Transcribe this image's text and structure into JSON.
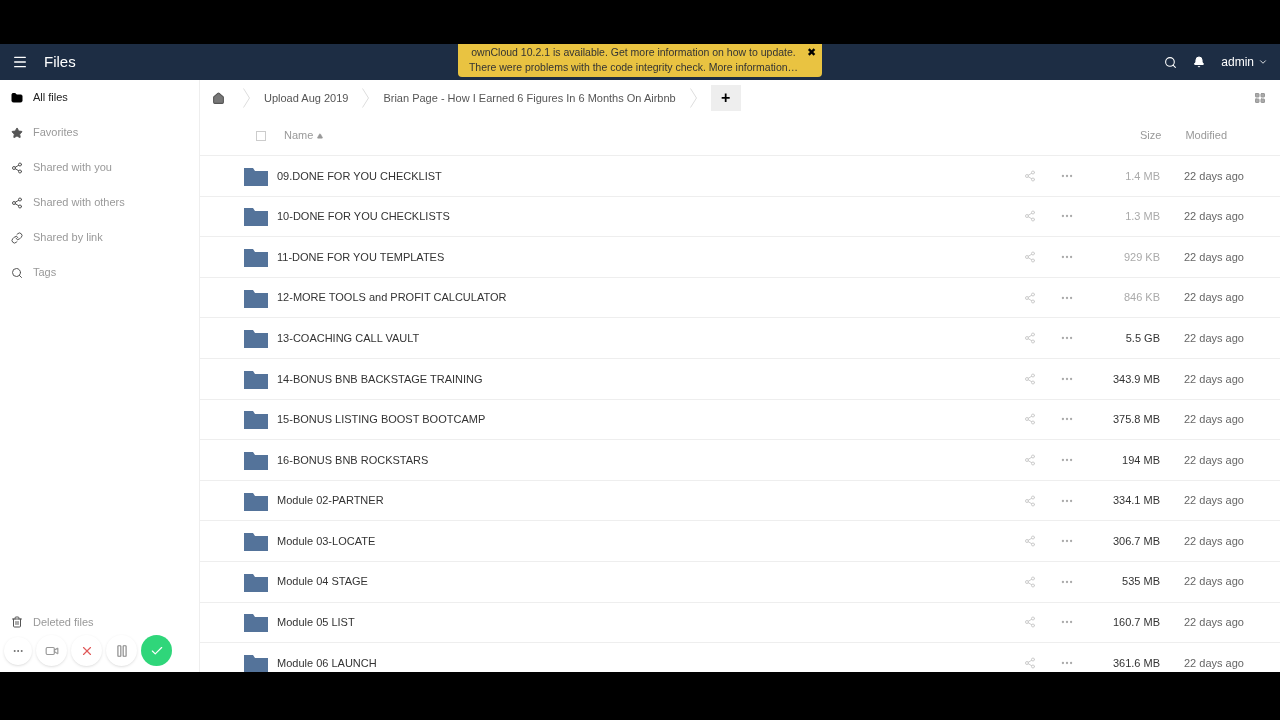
{
  "header": {
    "title": "Files",
    "user": "admin"
  },
  "notice": {
    "lines": [
      "ownCloud 10.2.1 is available. Get more information on how to update.",
      "There were problems with the code integrity check. More information…"
    ],
    "close": "✖"
  },
  "sidebar": {
    "items": [
      {
        "label": "All files",
        "selected": true
      },
      {
        "label": "Favorites",
        "selected": false
      },
      {
        "label": "Shared with you",
        "selected": false
      },
      {
        "label": "Shared with others",
        "selected": false
      },
      {
        "label": "Shared by link",
        "selected": false
      },
      {
        "label": "Tags",
        "selected": false
      }
    ],
    "bottom": {
      "label": "Deleted files"
    }
  },
  "breadcrumbs": [
    "Upload Aug 2019",
    "Brian Page - How I Earned 6 Figures In 6 Months On Airbnb"
  ],
  "new_button": "+",
  "table": {
    "select_all": {
      "checked": false
    },
    "columns": [
      "Name",
      "Size",
      "Modified"
    ],
    "rows": [
      {
        "name": "09.DONE FOR YOU CHECKLIST",
        "size": "1.4 MB",
        "modified": "22 days ago",
        "muted": true
      },
      {
        "name": "10-DONE FOR YOU CHECKLISTS",
        "size": "1.3 MB",
        "modified": "22 days ago",
        "muted": true
      },
      {
        "name": "11-DONE FOR YOU TEMPLATES",
        "size": "929 KB",
        "modified": "22 days ago",
        "muted": true
      },
      {
        "name": "12-MORE TOOLS and PROFIT CALCULATOR",
        "size": "846 KB",
        "modified": "22 days ago",
        "muted": true
      },
      {
        "name": "13-COACHING CALL VAULT",
        "size": "5.5 GB",
        "modified": "22 days ago",
        "muted": false
      },
      {
        "name": "14-BONUS BNB BACKSTAGE TRAINING",
        "size": "343.9 MB",
        "modified": "22 days ago",
        "muted": false
      },
      {
        "name": "15-BONUS LISTING BOOST BOOTCAMP",
        "size": "375.8 MB",
        "modified": "22 days ago",
        "muted": false
      },
      {
        "name": "16-BONUS BNB ROCKSTARS",
        "size": "194 MB",
        "modified": "22 days ago",
        "muted": false
      },
      {
        "name": "Module 02-PARTNER",
        "size": "334.1 MB",
        "modified": "22 days ago",
        "muted": false
      },
      {
        "name": "Module 03-LOCATE",
        "size": "306.7 MB",
        "modified": "22 days ago",
        "muted": false
      },
      {
        "name": "Module 04 STAGE",
        "size": "535 MB",
        "modified": "22 days ago",
        "muted": false
      },
      {
        "name": "Module 05 LIST",
        "size": "160.7 MB",
        "modified": "22 days ago",
        "muted": false
      },
      {
        "name": "Module 06 LAUNCH",
        "size": "361.6 MB",
        "modified": "22 days ago",
        "muted": false
      }
    ]
  }
}
